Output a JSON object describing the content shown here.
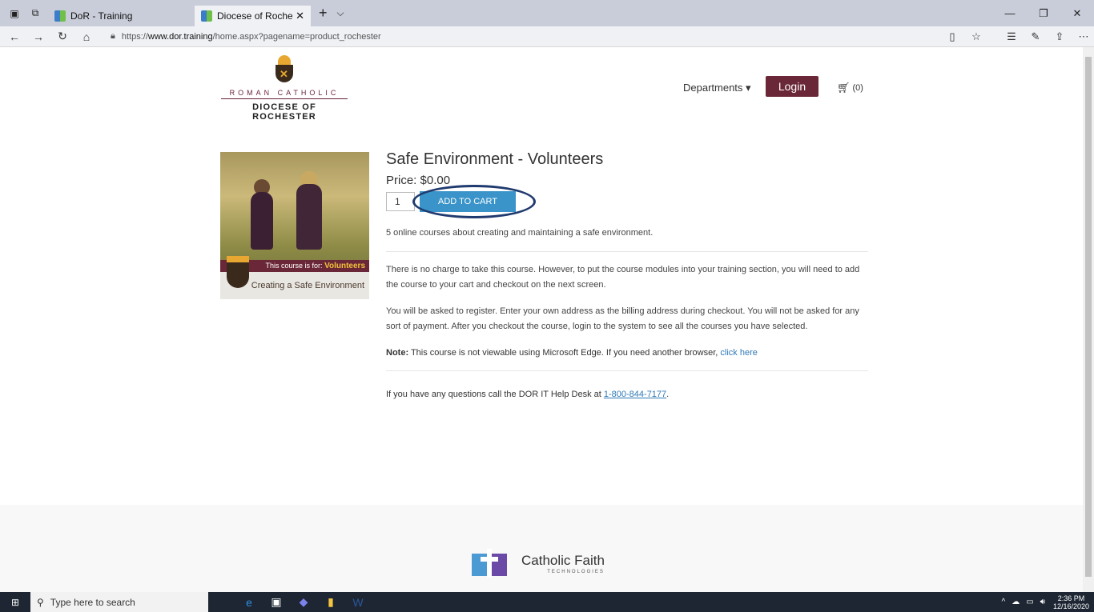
{
  "browser": {
    "tabs": [
      {
        "label": "DoR - Training"
      },
      {
        "label": "Diocese of Rochester - I"
      }
    ],
    "url_prefix": "https://",
    "url_domain": "www.dor.training",
    "url_path": "/home.aspx?pagename=product_rochester"
  },
  "site": {
    "logo_top": "ROMAN CATHOLIC",
    "logo_bottom": "DIOCESE OF ROCHESTER",
    "departments_label": "Departments",
    "login_label": "Login",
    "cart_count": "(0)"
  },
  "product": {
    "image_band_prefix": "This course is for:",
    "image_band_audience": "Volunteers",
    "image_footer": "Creating a Safe Environment",
    "title": "Safe Environment - Volunteers",
    "price": "Price: $0.00",
    "quantity": "1",
    "add_to_cart_label": "ADD TO CART",
    "summary": "5 online courses about creating and maintaining a safe environment.",
    "para1": "There is no charge to take this course.  However, to put the course modules into your training section, you will need to add the course to your cart and checkout on the next screen.",
    "para2": "You will be asked to register.  Enter your own address as the billing address during checkout.  You will not be asked for any sort of payment.  After you checkout the course, login to the system to see all the courses you have selected.",
    "note_label": "Note:",
    "note_text": " This course is not viewable using Microsoft Edge. If you need another browser, ",
    "note_link": "click here",
    "help_text": "If you have any questions call the DOR IT Help Desk at ",
    "help_phone": "1-800-844-7177",
    "help_end": "."
  },
  "footer": {
    "brand_name": "Catholic Faith",
    "brand_sub": "TECHNOLOGIES"
  },
  "taskbar": {
    "search_placeholder": "Type here to search",
    "time": "2:36 PM",
    "date": "12/16/2020"
  },
  "colors": {
    "accent_maroon": "#6a2737",
    "button_blue": "#3a94c9",
    "highlight_ring": "#1f3a6e",
    "link_blue": "#2f79b7"
  }
}
